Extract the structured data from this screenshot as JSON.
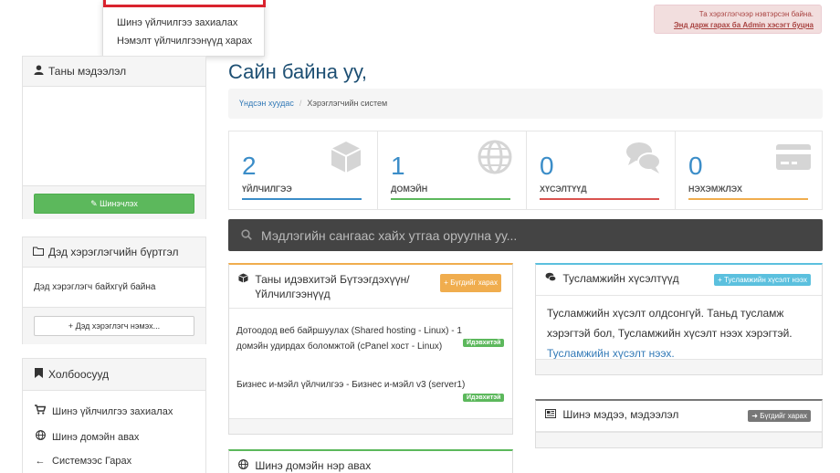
{
  "dropdown": {
    "items": [
      "Шинэ үйлчилгээ захиалах",
      "Нэмэлт үйлчилгээнүүд харах"
    ]
  },
  "alert": {
    "line1": "Та хэрэглэгчээр нэвтэрсэн байна.",
    "link": "Энд дарж гарах ба Admin хэсэгт буцна"
  },
  "sidebar": {
    "info": {
      "title": "Таны мэдээлэл",
      "button": "Шинэчлэх"
    },
    "subaccounts": {
      "title": "Дэд хэрэглэгчийн бүртгэл",
      "empty": "Дэд хэрэглэгч байхгүй байна",
      "button": "Дэд хэрэглэгч нэмэх..."
    },
    "shortcuts": {
      "title": "Холбоосууд",
      "items": [
        {
          "label": "Шинэ үйлчилгээ захиалах",
          "icon": "cart-icon"
        },
        {
          "label": "Шинэ домэйн авах",
          "icon": "globe-icon"
        },
        {
          "label": "Системээс Гарах",
          "icon": "arrow-left-icon"
        }
      ]
    }
  },
  "main": {
    "title": "Сайн байна уу,",
    "breadcrumb": {
      "home": "Үндсэн хуудас",
      "current": "Хэрэглэгчийн систем"
    },
    "stats": [
      {
        "value": "2",
        "label": "ҮЙЛЧИЛГЭЭ",
        "color": "#3b8dc8",
        "icon": "cube-icon"
      },
      {
        "value": "1",
        "label": "ДОМЭЙН",
        "color": "#5cb85c",
        "icon": "globe-icon"
      },
      {
        "value": "0",
        "label": "ХҮСЭЛТҮҮД",
        "color": "#d9534f",
        "icon": "comments-icon"
      },
      {
        "value": "0",
        "label": "НЭХЭМЖЛЭХ",
        "color": "#f0ad4e",
        "icon": "credit-card-icon"
      }
    ],
    "search": {
      "placeholder": "Мэдлэгийн сангаас хайх утгаа оруулна уу..."
    },
    "services_card": {
      "title": "Таны идэвхитэй Бүтээгдэхүүн/ Үйлчилгээнүүд",
      "button": "Бүгдийг харах",
      "items": [
        {
          "name": "Дотоодод веб байршуулах (Shared hosting - Linux) - 1 домэйн удирдах боломжтой (cPanel хост - Linux)",
          "status": "Идэвхитэй"
        },
        {
          "name": "Бизнес и-мэйл үйлчилгээ - Бизнес и-мэйл v3 (server1)",
          "status": "Идэвхитэй"
        }
      ]
    },
    "tickets_card": {
      "title": "Тусламжийн хүсэлтүүд",
      "button": "Тусламжийн хүсэлт нээх",
      "body": "Тусламжийн хүсэлт олдсонгүй. Таньд тусламж хэрэгтэй бол, Тусламжийн хүсэлт нээх хэрэгтэй.",
      "link": "Тусламжийн хүсэлт нээх."
    },
    "news_card": {
      "title": "Шинэ мэдээ, мэдээлэл",
      "button": "Бүгдийг харах"
    },
    "domain_card": {
      "title": "Шинэ домэйн нэр авах"
    }
  },
  "colors": {
    "accent": "#1d4f73",
    "link": "#337ab7",
    "green": "#5cb85c",
    "info": "#5bc0de",
    "warning": "#f0ad4e",
    "gray": "#777777"
  }
}
